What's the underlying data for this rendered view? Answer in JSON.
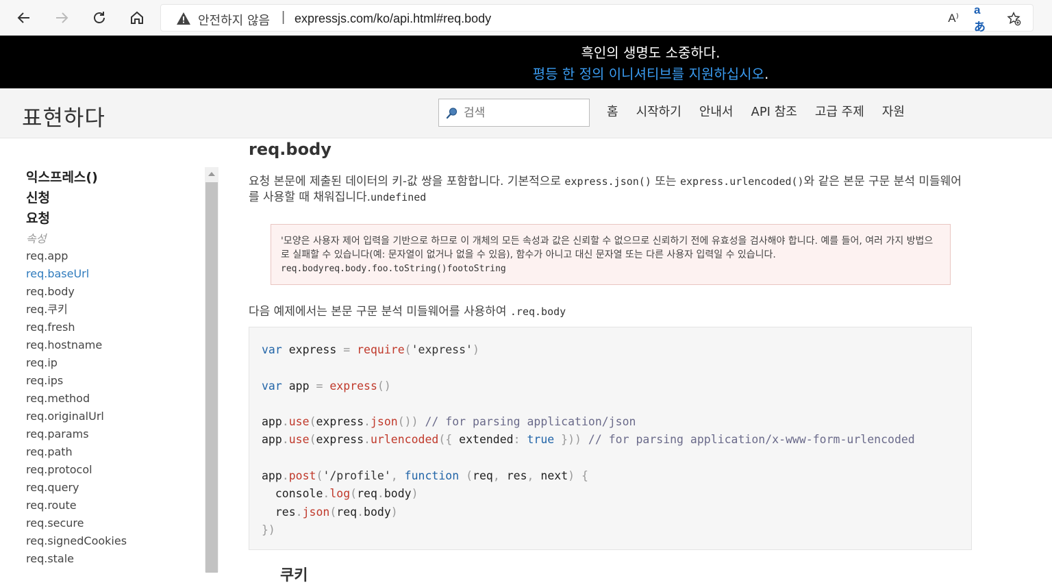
{
  "browser": {
    "insecure_label": "안전하지 않음",
    "separator": "|",
    "url": "expressjs.com/ko/api.html#req.body",
    "read_aloud_icon": "A⁾",
    "translate_icon": "aあ"
  },
  "banner": {
    "line1": "흑인의 생명도 소중하다.",
    "link_text": "평등 한 정의 이니셔티브를 지원하십시오",
    "line2_suffix": "."
  },
  "header": {
    "logo": "표현하다",
    "search_placeholder": "검색",
    "menu": [
      "홈",
      "시작하기",
      "안내서",
      "API 참조",
      "고급 주제",
      "자원"
    ]
  },
  "sidebar": {
    "headings": [
      "익스프레스()",
      "신청",
      "요청"
    ],
    "subheading": "속성",
    "items": [
      "req.app",
      "req.baseUrl",
      "req.body",
      "req.쿠키",
      "req.fresh",
      "req.hostname",
      "req.ip",
      "req.ips",
      "req.method",
      "req.originalUrl",
      "req.params",
      "req.path",
      "req.protocol",
      "req.query",
      "req.route",
      "req.secure",
      "req.signedCookies",
      "req.stale"
    ]
  },
  "main": {
    "title": "req.body",
    "para_a": "요청 본문에 제출된 데이터의 키-값 쌍을 포함합니다. 기본적으로 ",
    "para_code1": "express.json()",
    "para_b": " 또는 ",
    "para_code2": "express.urlencoded()",
    "para_c": "와 같은 본문 구문 분석 미들웨어를 사용할 때 채워집니다.",
    "para_code3": "undefined",
    "warning_text1": "'모양은 사용자 제어 입력을 기반으로 하므로 이 개체의 모든 속성과 값은 신뢰할 수 없으므로 신뢰하기 전에 유효성을 검사해야 합니다. 예를 들어, 여러 가지 방법으로 실패할 수 있습니다(예: 문자열이 없거나 없을 수 있음), 함수가 아니고 대신 문자열 또는 다른 사용자 입력일 수 있습니다.",
    "warning_code": "req.bodyreq.body.foo.toString()footoString",
    "para2": "다음 예제에서는 본문 구문 분석 미들웨어를 사용하여 ",
    "para2_code": ".req.body",
    "next_heading": "쿠키"
  }
}
